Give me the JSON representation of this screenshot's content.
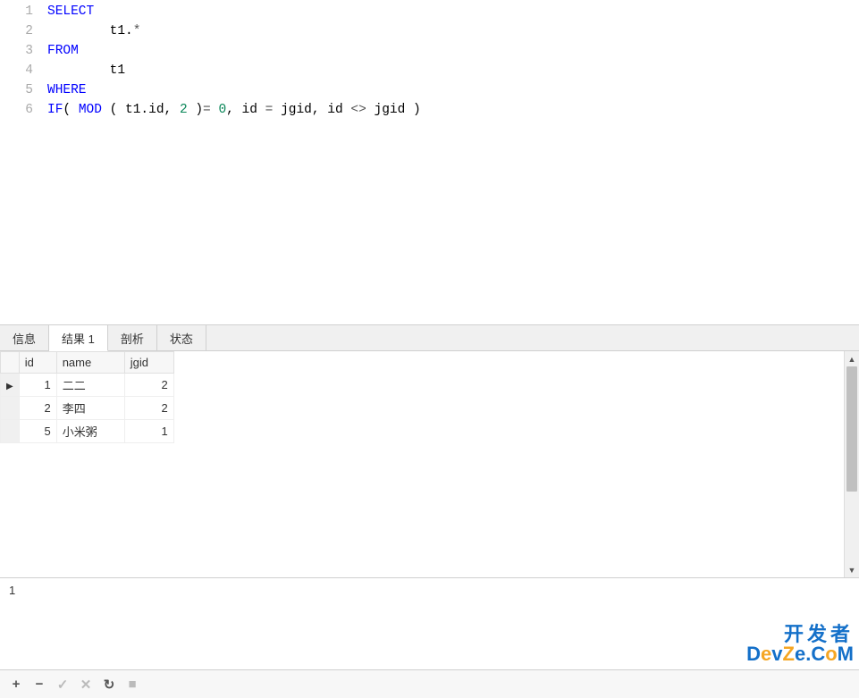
{
  "editor": {
    "lines": [
      {
        "num": "1",
        "tokens": [
          {
            "t": "SELECT",
            "c": "kw"
          }
        ]
      },
      {
        "num": "2",
        "tokens": [
          {
            "t": "\tt1.",
            "c": "txt"
          },
          {
            "t": "*",
            "c": "star"
          }
        ]
      },
      {
        "num": "3",
        "tokens": [
          {
            "t": "FROM",
            "c": "kw"
          }
        ]
      },
      {
        "num": "4",
        "tokens": [
          {
            "t": "\tt1",
            "c": "txt"
          }
        ]
      },
      {
        "num": "5",
        "tokens": [
          {
            "t": "WHERE",
            "c": "kw"
          }
        ]
      },
      {
        "num": "6",
        "tokens": [
          {
            "t": "IF",
            "c": "kw"
          },
          {
            "t": "( ",
            "c": "txt"
          },
          {
            "t": "MOD",
            "c": "fn"
          },
          {
            "t": " ( t1.id, ",
            "c": "txt"
          },
          {
            "t": "2",
            "c": "num"
          },
          {
            "t": " )",
            "c": "txt"
          },
          {
            "t": "=",
            "c": "op"
          },
          {
            "t": " ",
            "c": "txt"
          },
          {
            "t": "0",
            "c": "num"
          },
          {
            "t": ", id ",
            "c": "txt"
          },
          {
            "t": "=",
            "c": "op"
          },
          {
            "t": " jgid, id ",
            "c": "txt"
          },
          {
            "t": "<>",
            "c": "op"
          },
          {
            "t": " jgid )",
            "c": "txt"
          }
        ]
      }
    ]
  },
  "tabs": {
    "items": [
      {
        "label": "信息",
        "active": false
      },
      {
        "label": "结果 1",
        "active": true
      },
      {
        "label": "剖析",
        "active": false
      },
      {
        "label": "状态",
        "active": false
      }
    ]
  },
  "results": {
    "columns": [
      "id",
      "name",
      "jgid"
    ],
    "rows": [
      {
        "id": "1",
        "name": "二二",
        "jgid": "2",
        "current": true
      },
      {
        "id": "2",
        "name": "李四",
        "jgid": "2",
        "current": false
      },
      {
        "id": "5",
        "name": "小米粥",
        "jgid": "1",
        "current": false
      }
    ]
  },
  "status": {
    "text": "1"
  },
  "toolbar": {
    "buttons": [
      {
        "name": "add-button",
        "glyph": "+",
        "disabled": false
      },
      {
        "name": "remove-button",
        "glyph": "−",
        "disabled": false
      },
      {
        "name": "apply-button",
        "glyph": "✓",
        "disabled": true
      },
      {
        "name": "cancel-button",
        "glyph": "✕",
        "disabled": true
      },
      {
        "name": "refresh-button",
        "glyph": "↻",
        "disabled": false
      },
      {
        "name": "stop-button",
        "glyph": "■",
        "disabled": true
      }
    ]
  },
  "watermark": {
    "line1": "开发者",
    "line2_parts": [
      {
        "t": "D",
        "c": "d"
      },
      {
        "t": "e",
        "c": "o"
      },
      {
        "t": "v",
        "c": "d"
      },
      {
        "t": "Z",
        "c": "o"
      },
      {
        "t": "e",
        "c": "d"
      },
      {
        "t": ".",
        "c": "d"
      },
      {
        "t": "C",
        "c": "d"
      },
      {
        "t": "o",
        "c": "o"
      },
      {
        "t": "M",
        "c": "d"
      }
    ]
  }
}
